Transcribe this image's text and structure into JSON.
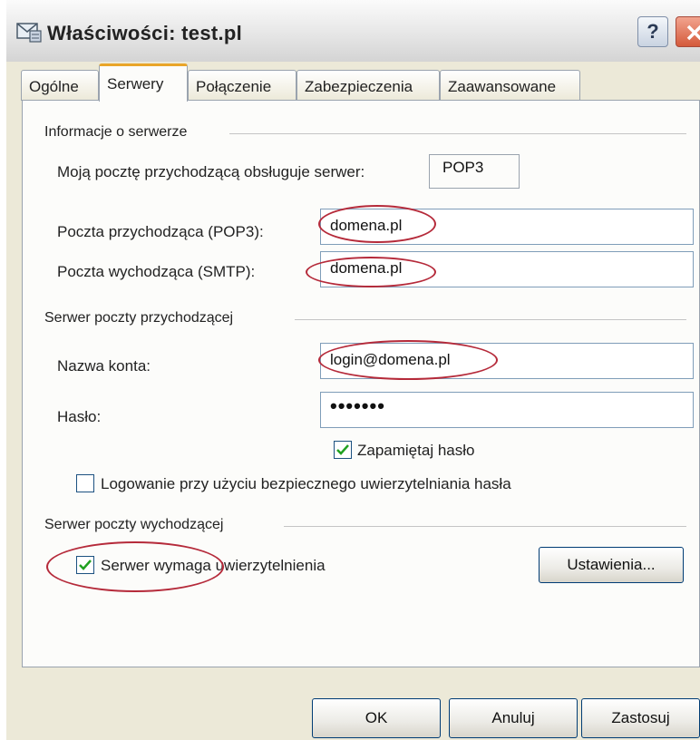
{
  "window": {
    "title": "Właściwości: test.pl"
  },
  "tabs": [
    {
      "label": "Ogólne",
      "active": false
    },
    {
      "label": "Serwery",
      "active": true
    },
    {
      "label": "Połączenie",
      "active": false
    },
    {
      "label": "Zabezpieczenia",
      "active": false
    },
    {
      "label": "Zaawansowane",
      "active": false
    }
  ],
  "server_info": {
    "group_label": "Informacje o serwerze",
    "incoming_type_label": "Moją pocztę przychodzącą obsługuje serwer:",
    "incoming_type_value": "POP3",
    "pop3_label": "Poczta przychodząca (POP3):",
    "pop3_value": "domena.pl",
    "smtp_label": "Poczta wychodząca (SMTP):",
    "smtp_value": "domena.pl"
  },
  "incoming_server": {
    "group_label": "Serwer poczty przychodzącej",
    "account_label": "Nazwa konta:",
    "account_value": "login@domena.pl",
    "password_label": "Hasło:",
    "password_value": "•••••••",
    "remember_password_label": "Zapamiętaj hasło",
    "remember_password_checked": true,
    "spa_label": "Logowanie przy użyciu bezpiecznego uwierzytelniania hasła",
    "spa_checked": false
  },
  "outgoing_server": {
    "group_label": "Serwer poczty wychodzącej",
    "auth_label": "Serwer wymaga uwierzytelnienia",
    "auth_checked": true,
    "settings_button": "Ustawienia..."
  },
  "buttons": {
    "ok": "OK",
    "cancel": "Anuluj",
    "apply": "Zastosuj"
  },
  "colors": {
    "highlight_ellipse": "#b52a3a",
    "active_tab_accent": "#e9a528",
    "checkmark": "#21a121"
  },
  "icons": {
    "title": "mail-server-icon",
    "help": "help-icon",
    "close": "close-icon",
    "check": "checkmark-icon"
  }
}
